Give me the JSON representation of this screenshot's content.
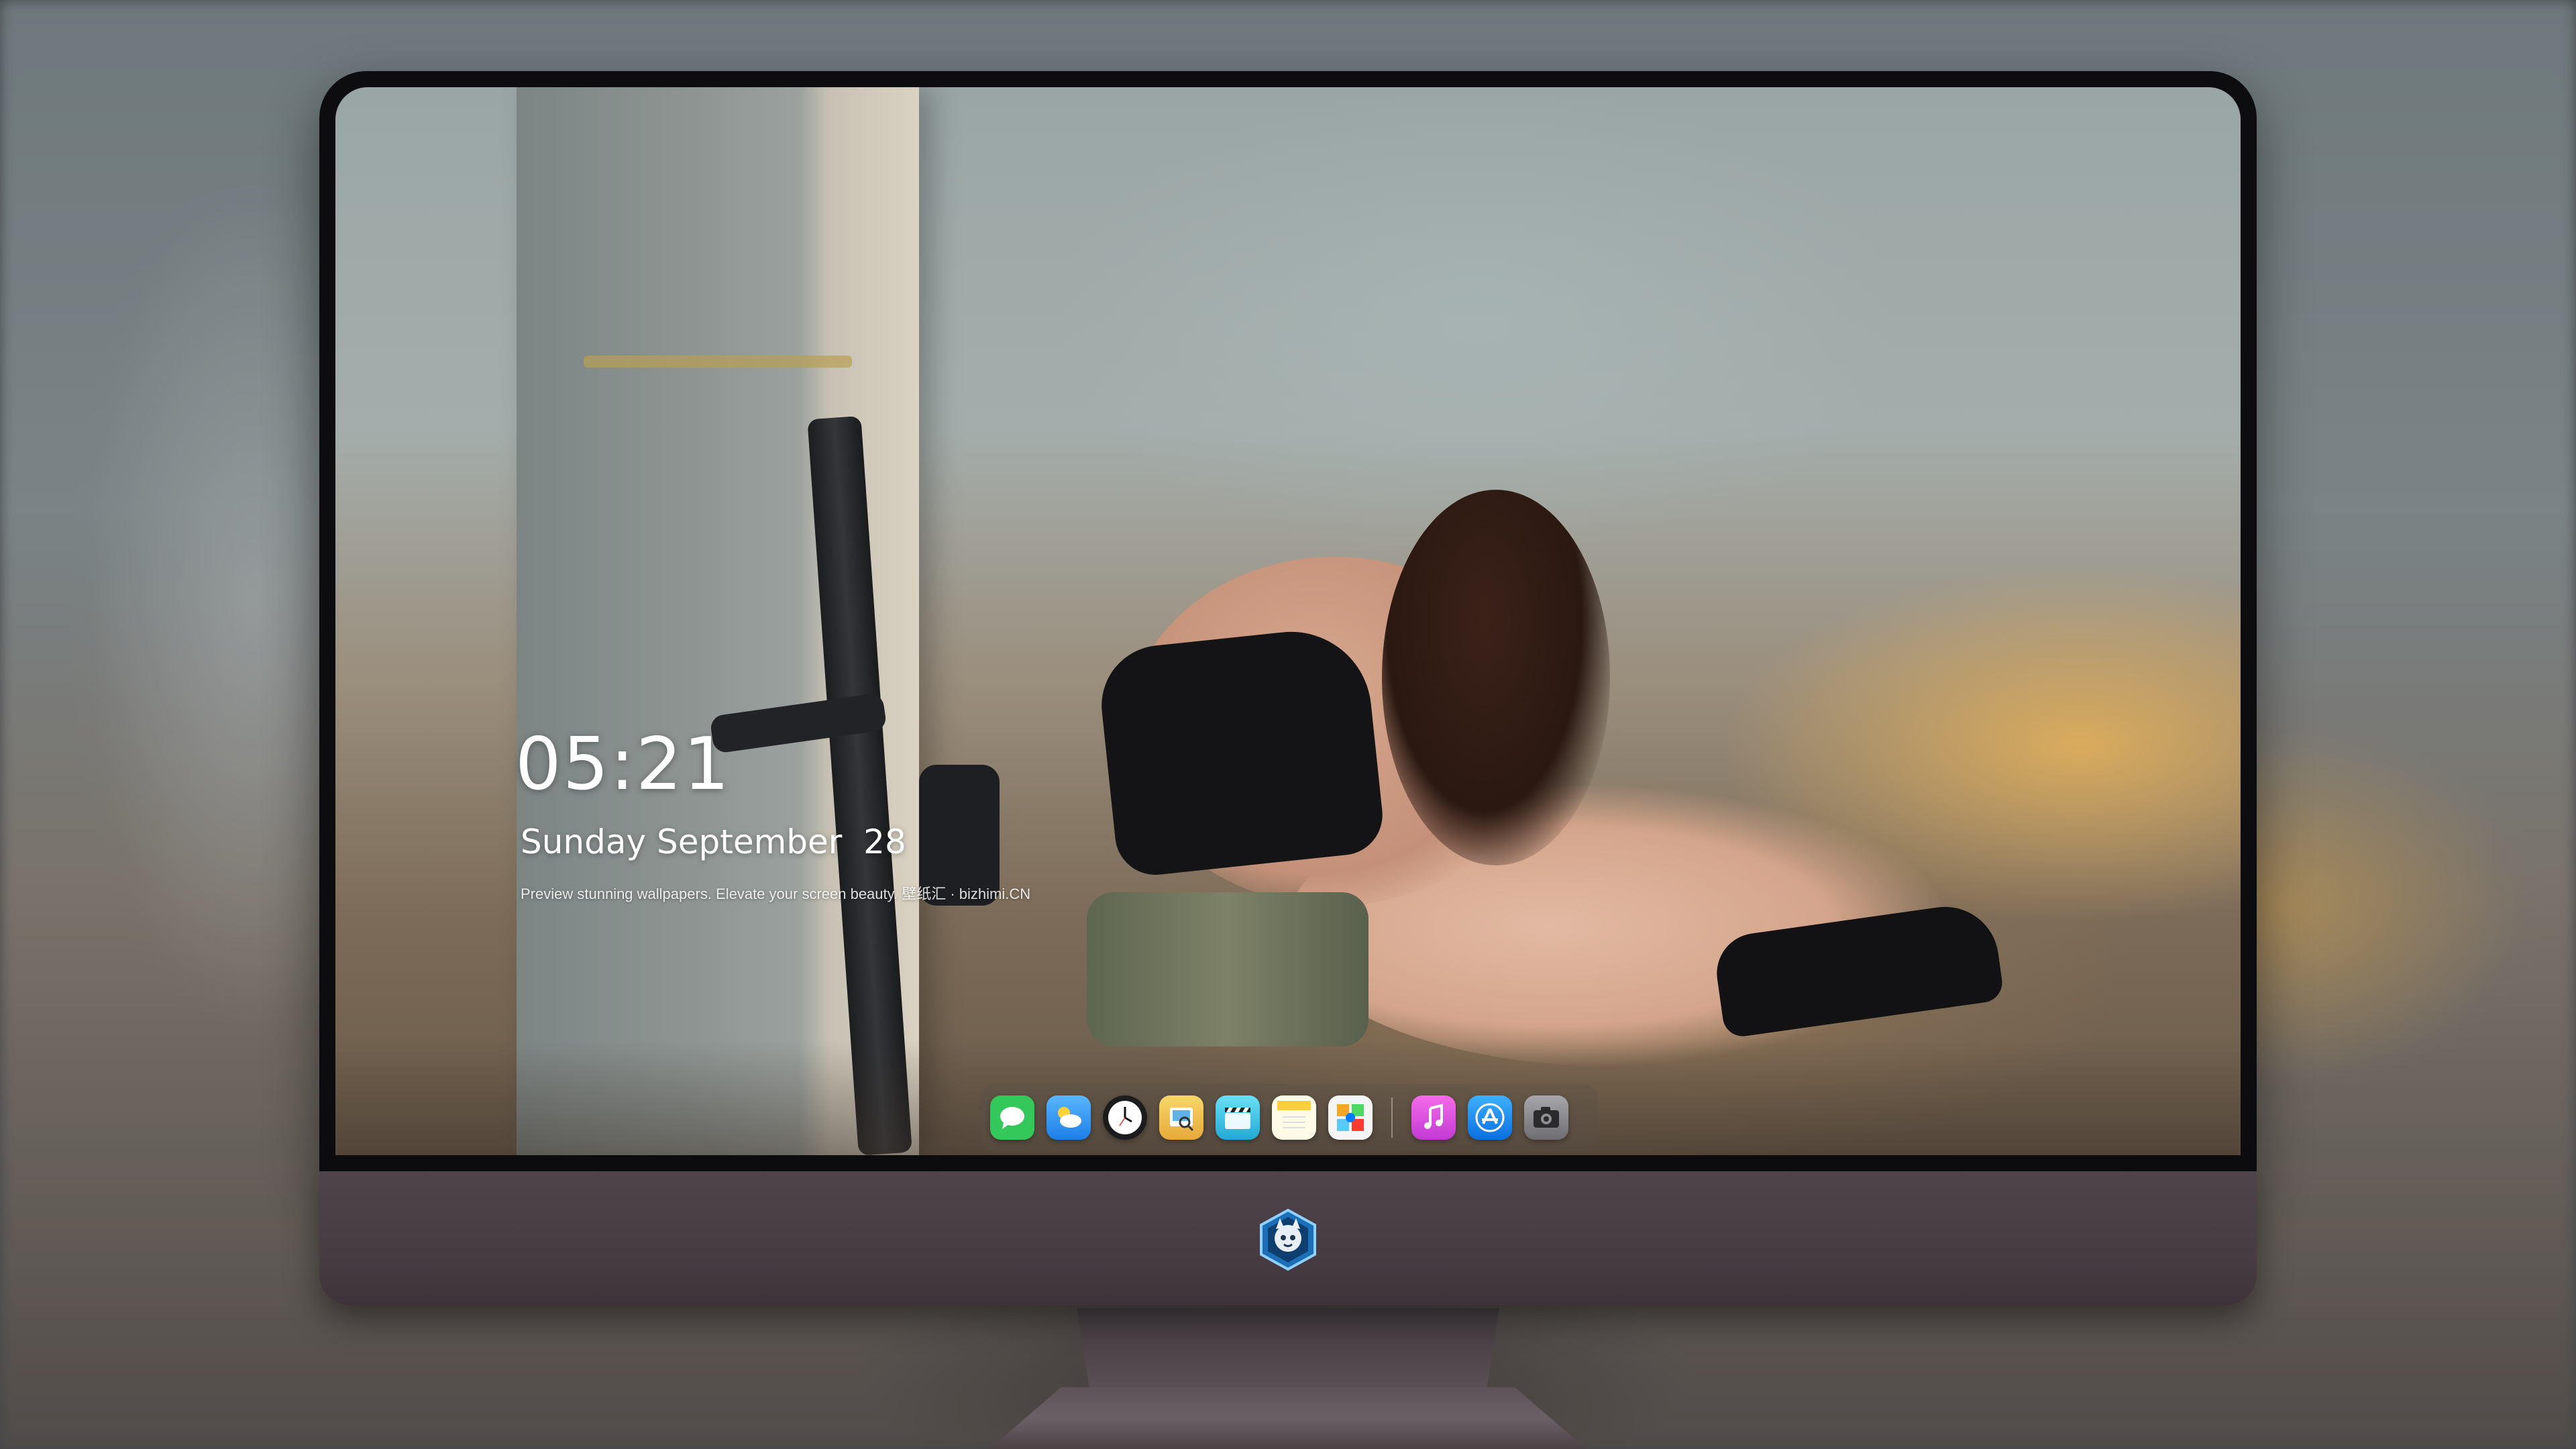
{
  "lockscreen": {
    "time": "05:21",
    "date": "Sunday September  28",
    "tagline": "Preview stunning wallpapers. Elevate your screen beauty. 壁纸汇 · bizhimi.CN"
  },
  "dock": {
    "apps": [
      {
        "name": "messages-icon",
        "color": "#34c759"
      },
      {
        "name": "weather-icon",
        "color": "#2f9bff"
      },
      {
        "name": "clock-icon",
        "color": "#1c1c1e"
      },
      {
        "name": "preview-icon",
        "color": "#f4c542"
      },
      {
        "name": "clips-icon",
        "color": "#3dc4e6"
      },
      {
        "name": "notes-icon",
        "color": "#ffd54a"
      },
      {
        "name": "photos-icon",
        "color": "#f5f5f5"
      },
      {
        "name": "itunes-icon",
        "color": "#e548d8"
      },
      {
        "name": "app-store-icon",
        "color": "#1e8cff"
      },
      {
        "name": "camera-icon",
        "color": "#8e8e93"
      }
    ]
  },
  "monitor": {
    "chin_color": "#4a3f44",
    "logo_name": "mascot-logo"
  }
}
